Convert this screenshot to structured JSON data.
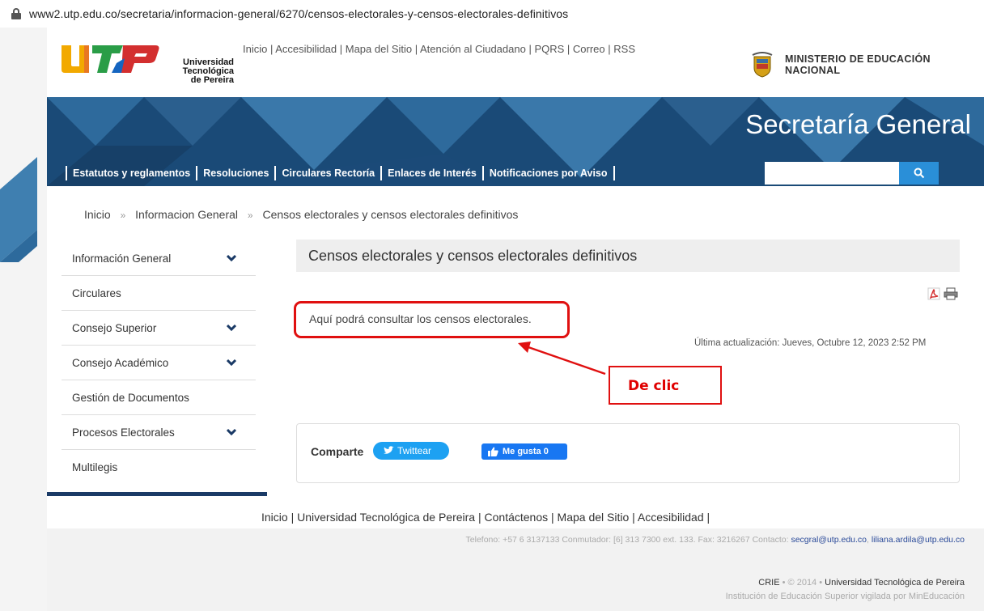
{
  "browser": {
    "url": "www2.utp.edu.co/secretaria/informacion-general/6270/censos-electorales-y-censos-electorales-definitivos"
  },
  "header": {
    "logo_text": [
      "Universidad",
      "Tecnológica",
      "de Pereira"
    ],
    "top_links": [
      "Inicio",
      "Accesibilidad",
      "Mapa del Sitio",
      "Atención al Ciudadano",
      "PQRS",
      "Correo",
      "RSS"
    ],
    "ministry": [
      "MINISTERIO DE EDUCACIÓN",
      "NACIONAL"
    ]
  },
  "banner": {
    "title": "Secretaría General"
  },
  "nav": {
    "items": [
      "Estatutos y reglamentos",
      "Resoluciones",
      "Circulares Rectoría",
      "Enlaces de Interés",
      "Notificaciones por Aviso"
    ]
  },
  "breadcrumb": {
    "home": "Inicio",
    "section": "Informacion General",
    "current": "Censos electorales y censos electorales definitivos",
    "separator": "»"
  },
  "sidebar": {
    "items": [
      {
        "label": "Información General",
        "expandable": true
      },
      {
        "label": "Circulares",
        "expandable": false
      },
      {
        "label": "Consejo Superior",
        "expandable": true
      },
      {
        "label": "Consejo Académico",
        "expandable": true
      },
      {
        "label": "Gestión de Documentos",
        "expandable": false
      },
      {
        "label": "Procesos Electorales",
        "expandable": true
      },
      {
        "label": "Multilegis",
        "expandable": false
      }
    ]
  },
  "content": {
    "title": "Censos electorales y censos electorales definitivos",
    "intro": "Aquí podrá consultar los censos electorales.",
    "updated": "Última actualización: Jueves, Octubre 12, 2023 2:52 PM",
    "annotation": "De clic"
  },
  "share": {
    "label": "Comparte",
    "tweet": "Twittear",
    "like": "Me gusta 0"
  },
  "footer": {
    "links": [
      "Inicio",
      "Universidad Tecnológica de Pereira",
      "Contáctenos",
      "Mapa del Sitio",
      "Accesibilidad"
    ],
    "contact_prefix": "Telefono: +57 6 3137133 Conmutador: [6] 313 7300 ext. 133. Fax: 3216267 Contacto:",
    "email1": "secgral@utp.edu.co",
    "email2": "liliana.ardila@utp.edu.co",
    "copy_a": "CRIE",
    "copy_b": "© 2014",
    "copy_c": "Universidad Tecnológica de Pereira",
    "copy2": "Institución de Educación Superior vigilada por MinEducación"
  },
  "colors": {
    "banner": "#1a4a77",
    "accent": "#2a8fd8",
    "annotation": "#e01010"
  }
}
